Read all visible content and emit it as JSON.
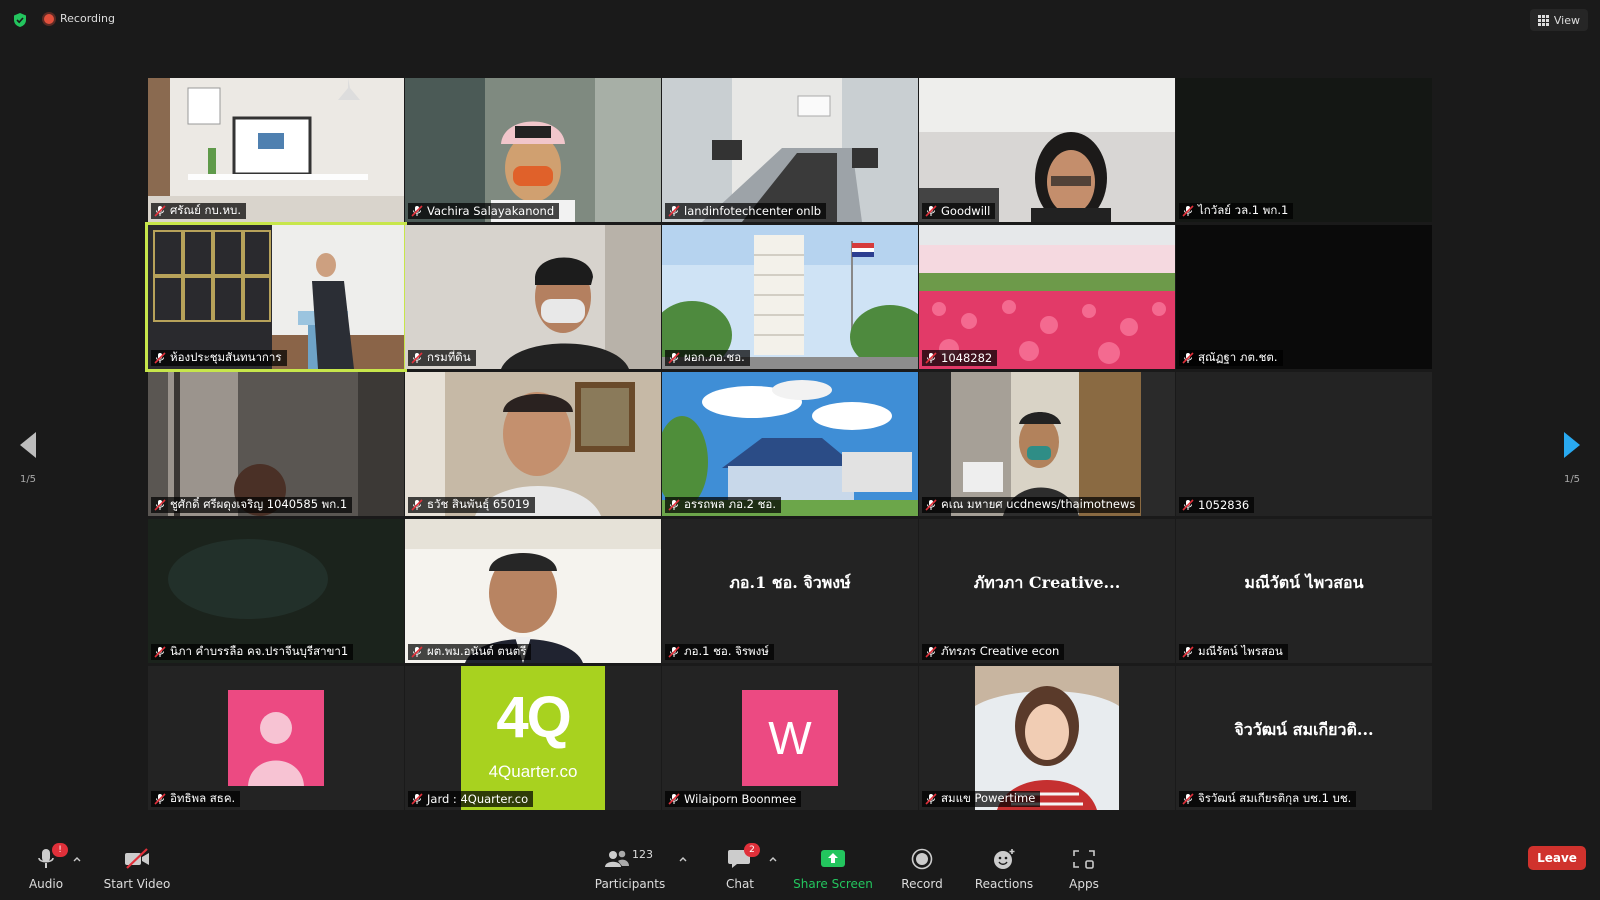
{
  "topbar": {
    "recording_label": "Recording",
    "view_label": "View"
  },
  "pager": {
    "left_page": "1/5",
    "right_page": "1/5"
  },
  "tiles": [
    {
      "name": "ศรัณย์ กบ.หบ.",
      "video": "office-desk"
    },
    {
      "name": "Vachira Salayakanond",
      "video": "person-cap"
    },
    {
      "name": "landinfotechcenter onlb",
      "video": "conference-room"
    },
    {
      "name": "Goodwill",
      "video": "person-glasses"
    },
    {
      "name": "ไกวัลย์ วล.1 พก.1",
      "video": "dark"
    },
    {
      "name": "ห้องประชุมสันทนาการ",
      "video": "podium-speaker",
      "active": true
    },
    {
      "name": "กรมที่ดิน",
      "video": "person-mask"
    },
    {
      "name": "ผอก.ภอ.ชอ.",
      "video": "tower-flag"
    },
    {
      "name": "1048282",
      "video": "tulips"
    },
    {
      "name": "สุณัฏฐา ภต.ชต.",
      "video": "black"
    },
    {
      "name": "ชูศักดิ์ ศรีผดุงเจริญ 1040585 พก.1",
      "video": "dim-room"
    },
    {
      "name": "ธวัช สินพันธุ์ 65019",
      "video": "man-office"
    },
    {
      "name": "อรรถพล ภอ.2 ชอ.",
      "video": "building-sky"
    },
    {
      "name": "คเณ มหายศ ucdnews/thaimotnews",
      "video": "man-window"
    },
    {
      "name": "1052836",
      "video": "empty"
    },
    {
      "name": "นิภา คำบรรลือ คจ.ปราจีนบุรีสาขา1",
      "video": "dark-green"
    },
    {
      "name": "ผต.พม.อนันต์ ตนตรี",
      "video": "man-suit"
    },
    {
      "name": "ภอ.1 ชอ. จิรพงษ์",
      "video": "none",
      "display_name": "ภอ.1 ชอ. จิวพงษ์"
    },
    {
      "name": "ภัทรภร Creative econ",
      "video": "none",
      "display_name": "ภัทวภา Creative..."
    },
    {
      "name": "มณีรัตน์ ไพรสอน",
      "video": "none",
      "display_name": "มณีวัตน์ ไพวสอน"
    },
    {
      "name": "อิทธิพล สธค.",
      "video": "avatar-person"
    },
    {
      "name": "Jard : 4Quarter.co",
      "video": "logo-4q",
      "logo_text": "4Q",
      "logo_sub": "4Quarter.co",
      "logo_color": "#a8d21f"
    },
    {
      "name": "Wilaiporn Boonmee",
      "video": "avatar-letter",
      "letter": "W"
    },
    {
      "name": "สมแข Powertime",
      "video": "portrait-woman"
    },
    {
      "name": "จิรวัฒน์ สมเกียรติกุล บช.1 บช.",
      "video": "none",
      "display_name": "จิววัฒน์ สมเกียวติ..."
    }
  ],
  "toolbar": {
    "audio_label": "Audio",
    "audio_badge": "!",
    "video_label": "Start Video",
    "participants_label": "Participants",
    "participants_count": "123",
    "chat_label": "Chat",
    "chat_badge": "2",
    "share_label": "Share Screen",
    "record_label": "Record",
    "reactions_label": "Reactions",
    "apps_label": "Apps",
    "leave_label": "Leave"
  },
  "colors": {
    "background": "#1a1a1a",
    "tile": "#232323",
    "active_border": "#c7e64b",
    "share_green": "#23c55e",
    "leave_red": "#d0322d",
    "avatar_pink": "#ec4a82"
  }
}
